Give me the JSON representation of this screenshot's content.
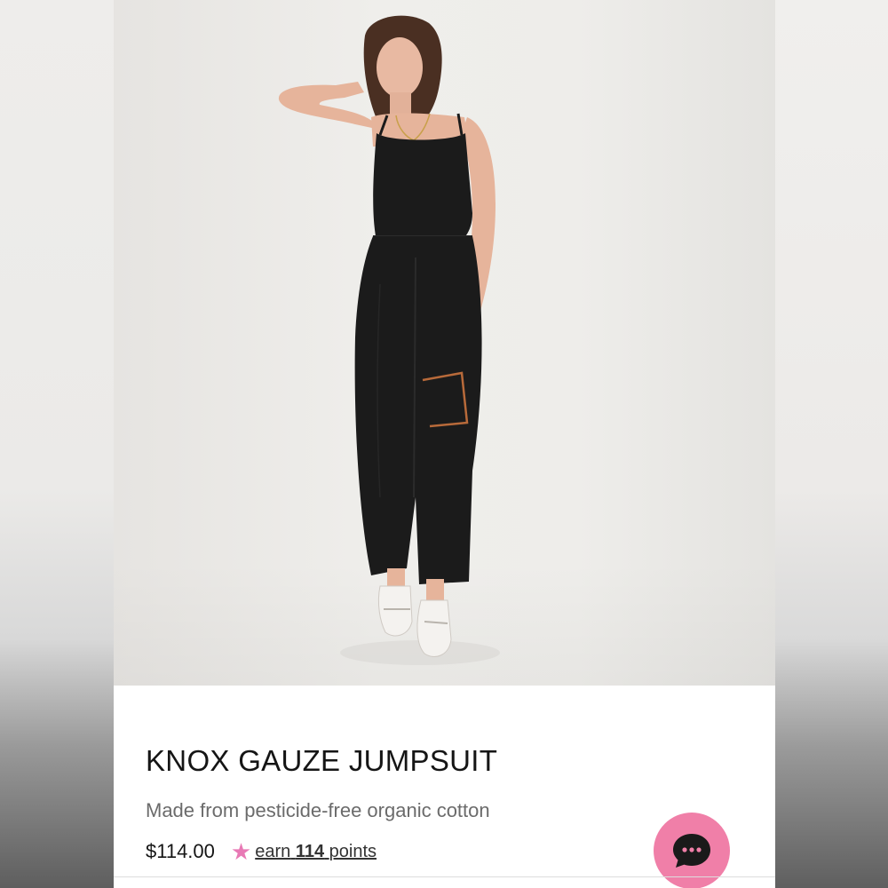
{
  "product": {
    "title": "KNOX GAUZE JUMPSUIT",
    "subtitle": "Made from pesticide-free organic cotton",
    "price": "$114.00",
    "rewards": {
      "prefix": "earn",
      "points": "114",
      "suffix": "points",
      "icon": "star-icon"
    },
    "image": {
      "icon": "product-photo"
    }
  },
  "chat": {
    "icon": "chat-bubble-icon"
  },
  "colors": {
    "accent_pink": "#f07fa8",
    "star_pink": "#e879b5",
    "garment": "#1b1b1b"
  }
}
